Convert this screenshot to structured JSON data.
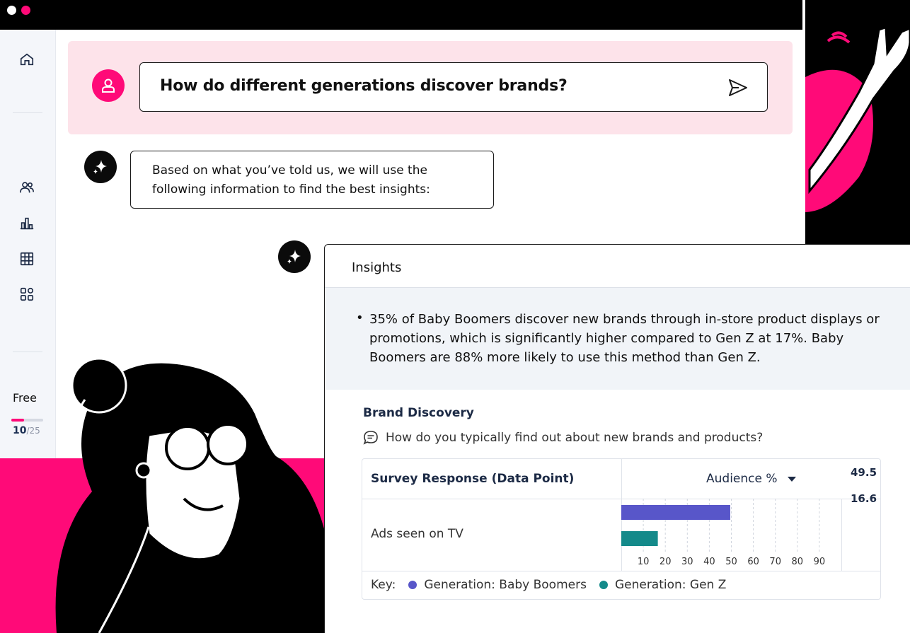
{
  "window": {
    "dot_colors": [
      "#ffffff",
      "#ff0a78"
    ]
  },
  "colors": {
    "accent": "#ff0a78",
    "series_boomers": "#5856c9",
    "series_genz": "#148a8a",
    "query_band": "#fde3ea"
  },
  "sidebar": {
    "icons": [
      "home-icon",
      "people-icon",
      "bar-chart-icon",
      "table-icon",
      "dashboard-icon"
    ],
    "plan_label": "Free",
    "usage_used": "10",
    "usage_total": "/25",
    "usage_fraction": 0.4
  },
  "query": {
    "text": "How do different generations discover brands?"
  },
  "bot": {
    "line1": "Based on what you’ve told us, we will use the",
    "line2": "following information to find the best insights:"
  },
  "insights": {
    "title": "Insights",
    "summary": "35% of Baby Boomers discover new brands through in-store product displays or promotions, which is significantly higher compared to Gen Z at 17%. Baby Boomers are 88% more likely to use this method than Gen Z.",
    "section_title": "Brand Discovery",
    "question": "How do you typically find out about new brands and products?",
    "table": {
      "col1_header": "Survey Response (Data Point)",
      "col2_header": "Audience %",
      "key_label": "Key:"
    }
  },
  "chart_data": {
    "type": "bar",
    "orientation": "horizontal",
    "categories": [
      "Ads seen on TV"
    ],
    "series": [
      {
        "name": "Generation: Baby Boomers",
        "values": [
          49.5
        ],
        "color": "#5856c9"
      },
      {
        "name": "Generation: Gen Z",
        "values": [
          16.6
        ],
        "color": "#148a8a"
      }
    ],
    "x_ticks": [
      10,
      20,
      30,
      40,
      50,
      60,
      70,
      80,
      90
    ],
    "xlim": [
      0,
      100
    ],
    "grid": true
  }
}
